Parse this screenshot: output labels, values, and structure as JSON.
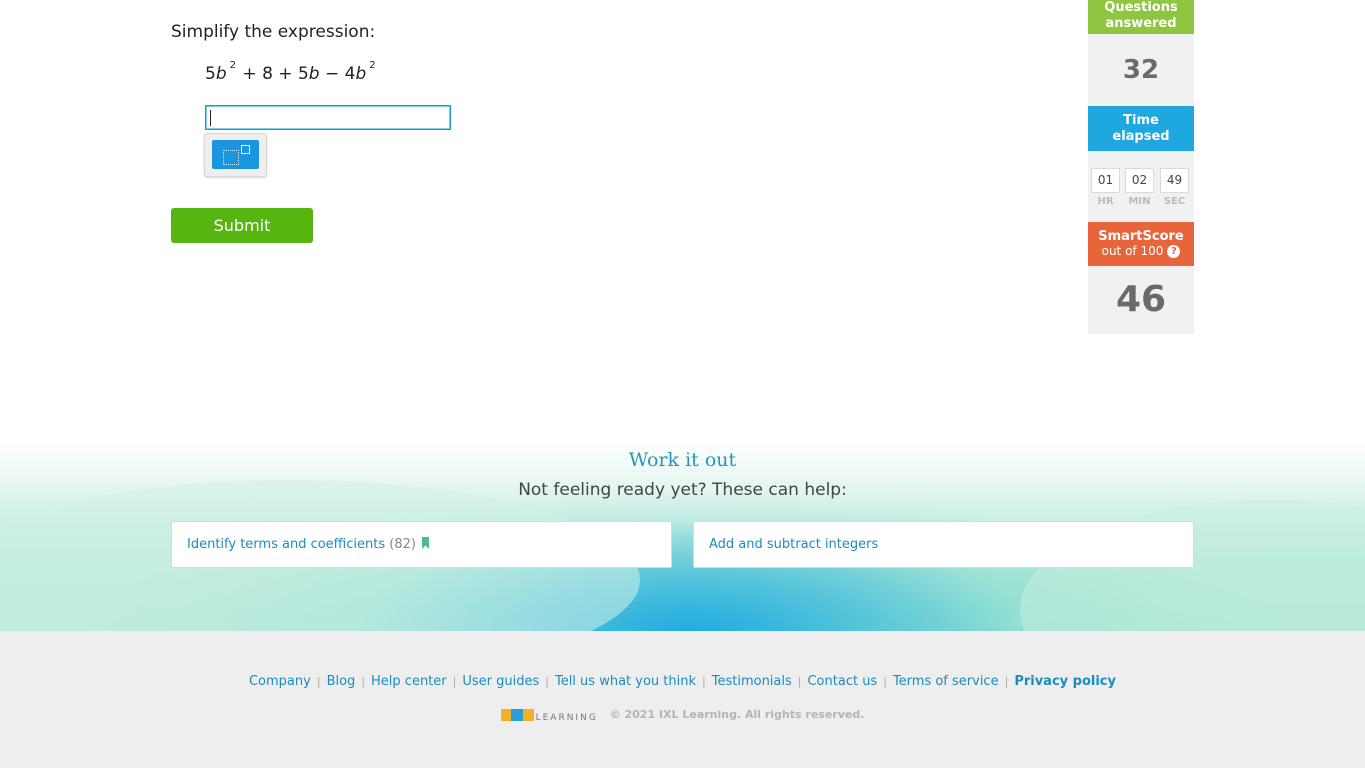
{
  "question": {
    "prompt": "Simplify the expression:",
    "expression": {
      "t1_coef": "5",
      "t1_var": "b",
      "t1_exp": "2",
      "op1": "+",
      "t2": "8",
      "op2": "+",
      "t3_coef": "5",
      "t3_var": "b",
      "op3": "−",
      "t4_coef": "4",
      "t4_var": "b",
      "t4_exp": "2"
    },
    "answer_value": "",
    "keypad_icon": "fraction-exponent-keypad-icon",
    "submit_label": "Submit"
  },
  "sidebar": {
    "questions_answered_label_1": "Questions",
    "questions_answered_label_2": "answered",
    "questions_answered_value": "32",
    "time_elapsed_label_1": "Time",
    "time_elapsed_label_2": "elapsed",
    "time": {
      "hr": "01",
      "min": "02",
      "sec": "49",
      "hr_label": "HR",
      "min_label": "MIN",
      "sec_label": "SEC"
    },
    "smartscore_label": "SmartScore",
    "smartscore_sub": "out of 100",
    "smartscore_help": "?",
    "smartscore_value": "46"
  },
  "work_it_out": {
    "title": "Work it out",
    "subtitle": "Not feeling ready yet? These can help:",
    "skills": [
      {
        "label": "Identify terms and coefficients",
        "count": "(82)"
      },
      {
        "label": "Add and subtract integers"
      }
    ]
  },
  "footer": {
    "links": [
      "Company",
      "Blog",
      "Help center",
      "User guides",
      "Tell us what you think",
      "Testimonials",
      "Contact us",
      "Terms of service",
      "Privacy policy"
    ],
    "logo_text": "IXL",
    "logo_sub": "LEARNING",
    "copyright": "© 2021 IXL Learning. All rights reserved."
  },
  "colors": {
    "green": "#56b50e",
    "questions_green": "#8ec63f",
    "time_blue": "#1fa8e0",
    "smartscore_orange": "#e8643a",
    "link_blue": "#1a8cbf"
  }
}
